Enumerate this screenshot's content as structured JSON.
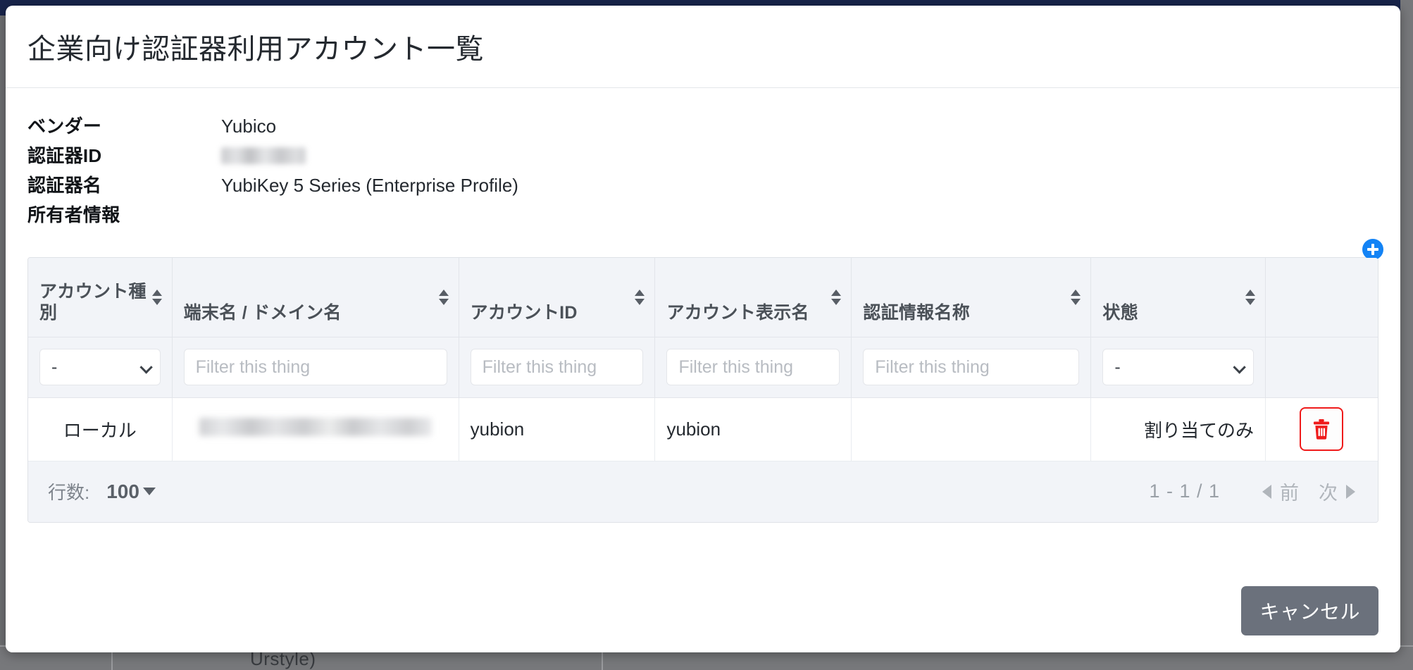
{
  "backdrop": {
    "ghost_text": "Urstyle)"
  },
  "modal": {
    "title": "企業向け認証器利用アカウント一覧",
    "info": [
      {
        "label": "ベンダー",
        "value": "Yubico",
        "redacted": false
      },
      {
        "label": "認証器ID",
        "value": "",
        "redacted": true
      },
      {
        "label": "認証器名",
        "value": "YubiKey 5 Series (Enterprise Profile)",
        "redacted": false
      },
      {
        "label": "所有者情報",
        "value": "",
        "redacted": false
      }
    ],
    "add_button_label": "追加",
    "cancel_label": "キャンセル"
  },
  "table": {
    "columns": [
      {
        "label": "アカウント種別",
        "sortable": true,
        "filter_type": "select",
        "filter_value": "-"
      },
      {
        "label": "端末名 / ドメイン名",
        "sortable": true,
        "filter_type": "text",
        "filter_placeholder": "Filter this thing"
      },
      {
        "label": "アカウントID",
        "sortable": true,
        "filter_type": "text",
        "filter_placeholder": "Filter this thing"
      },
      {
        "label": "アカウント表示名",
        "sortable": true,
        "filter_type": "text",
        "filter_placeholder": "Filter this thing"
      },
      {
        "label": "認証情報名称",
        "sortable": true,
        "filter_type": "text",
        "filter_placeholder": "Filter this thing"
      },
      {
        "label": "状態",
        "sortable": true,
        "filter_type": "select",
        "filter_value": "-"
      },
      {
        "label": "",
        "sortable": false,
        "filter_type": "none"
      }
    ],
    "rows": [
      {
        "account_type": "ローカル",
        "device_name": "",
        "device_name_redacted": true,
        "account_id": "yubion",
        "display_name": "yubion",
        "credential_name": "",
        "status": "割り当てのみ",
        "delete_label": "削除"
      }
    ],
    "footer": {
      "rows_label": "行数:",
      "rows_value": "100",
      "range": "1 - 1 / 1",
      "prev_label": "前",
      "next_label": "次"
    }
  },
  "colors": {
    "accent_blue": "#1383f5",
    "delete_red": "#ef1b1b",
    "header_bg": "#f2f4f8",
    "cancel_gray": "#6b717c",
    "navbar_navy": "#18244b"
  }
}
